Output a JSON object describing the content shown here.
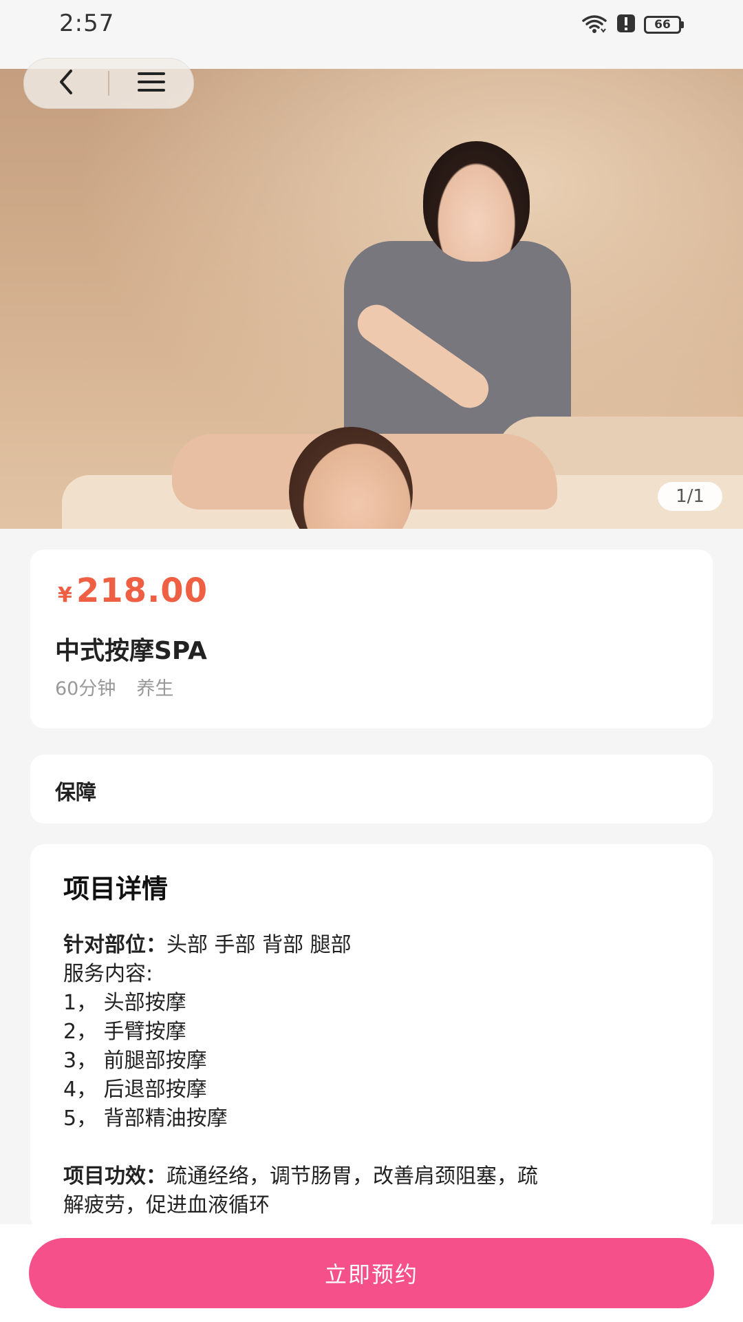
{
  "status_bar": {
    "time": "2:57",
    "battery": "66"
  },
  "gallery": {
    "counter": "1/1"
  },
  "product": {
    "currency_symbol": "¥",
    "price": "218.00",
    "title": "中式按摩SPA",
    "tags": [
      "60分钟",
      "养生"
    ]
  },
  "guarantee": {
    "label": "保障"
  },
  "detail": {
    "heading": "项目详情",
    "target_label": "针对部位：",
    "target_value": "头部 手部 背部 腿部",
    "content_label": "服务内容:",
    "content_items": [
      "1，  头部按摩",
      "2，  手臂按摩",
      "3，  前腿部按摩",
      "4，  后退部按摩",
      "5，  背部精油按摩"
    ],
    "effect_label": "项目功效：",
    "effect_line1": "疏通经络，调节肠胃，改善肩颈阻塞，疏",
    "effect_line2": "解疲劳，促进血液循环"
  },
  "actions": {
    "book_now": "立即预约"
  },
  "colors": {
    "price": "#ee5f43",
    "accent_button": "#f5508a"
  },
  "icons": {
    "back": "chevron-left-icon",
    "menu": "menu-icon",
    "wifi": "wifi-icon",
    "alert": "alert-icon",
    "battery": "battery-icon"
  }
}
